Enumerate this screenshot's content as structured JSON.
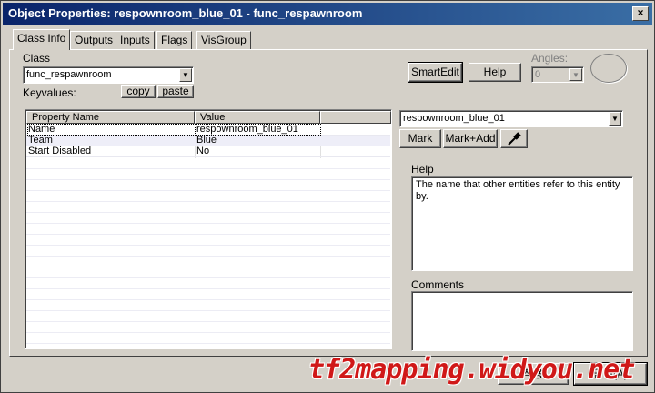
{
  "window": {
    "title": "Object Properties: respownroom_blue_01 - func_respawnroom",
    "close_glyph": "×"
  },
  "tabs": [
    {
      "label": "Class Info",
      "active": true
    },
    {
      "label": "Outputs"
    },
    {
      "label": "Inputs"
    },
    {
      "label": "Flags"
    },
    {
      "label": "VisGroup"
    }
  ],
  "class_section": {
    "class_label": "Class",
    "class_value": "func_respawnroom",
    "keyvalues_label": "Keyvalues:",
    "copy_label": "copy",
    "paste_label": "paste"
  },
  "toolbar": {
    "smartedit_label": "SmartEdit",
    "help_label": "Help",
    "angles_label": "Angles:",
    "angles_value": "0"
  },
  "grid": {
    "columns": [
      "Property Name",
      "Value"
    ],
    "rows": [
      {
        "name": "Name",
        "value": "respownroom_blue_01"
      },
      {
        "name": "Team",
        "value": "Blue"
      },
      {
        "name": "Start Disabled",
        "value": "No"
      }
    ]
  },
  "value_editor": {
    "value": "respownroom_blue_01",
    "mark_label": "Mark",
    "mark_add_label": "Mark+Add",
    "eyedropper_icon": "eyedropper-icon"
  },
  "help": {
    "label": "Help",
    "text": "The name that other entities refer to this entity by."
  },
  "comments": {
    "label": "Comments",
    "text": ""
  },
  "footer": {
    "apply_label": "적용",
    "close_label": "닫기(A)"
  },
  "watermark": "tf2mapping.widyou.net",
  "colors": {
    "titlebar_start": "#0a246a",
    "titlebar_end": "#3a6ea5",
    "watermark": "#d01818"
  }
}
